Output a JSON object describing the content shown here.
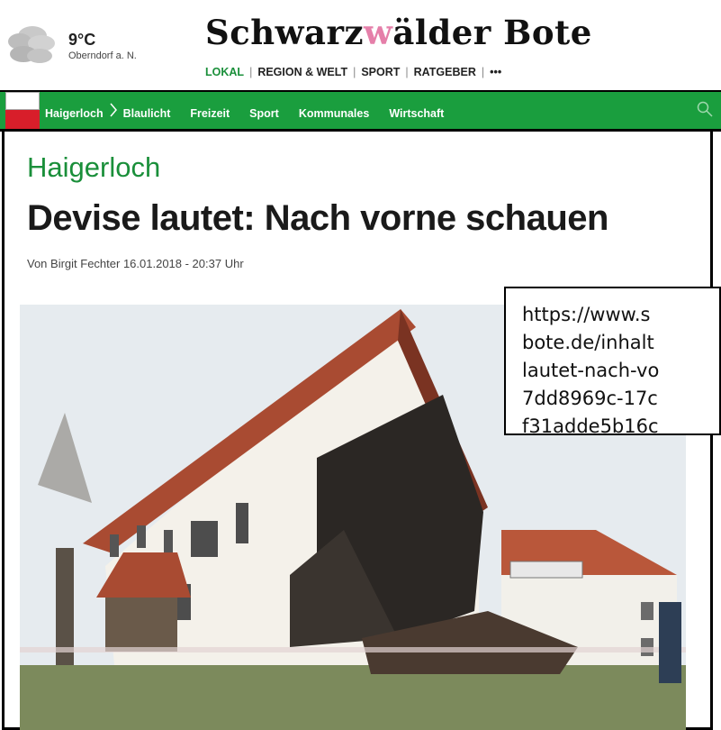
{
  "weather": {
    "temperature": "9°C",
    "location": "Oberndorf a. N."
  },
  "brand": {
    "logo_text_1": "Schwarz",
    "logo_mask": "w",
    "logo_text_2": "älder Bote"
  },
  "top_nav": {
    "items": [
      "LOKAL",
      "REGION & WELT",
      "SPORT",
      "RATGEBER",
      "•••"
    ]
  },
  "green_nav": {
    "items": [
      "Haigerloch",
      "Blaulicht",
      "Freizeit",
      "Sport",
      "Kommunales",
      "Wirtschaft"
    ]
  },
  "article": {
    "kicker": "Haigerloch",
    "headline": "Devise lautet: Nach vorne schauen",
    "byline": "Von Birgit Fechter 16.01.2018 - 20:37 Uhr"
  },
  "url_overlay": {
    "lines": [
      "https://www.s",
      "bote.de/inhalt",
      "lautet-nach-vo",
      "7dd8969c-17c",
      "f31adde5b16c"
    ]
  },
  "colors": {
    "accent": "#1a9e3e",
    "flag_red": "#d81e2a"
  }
}
